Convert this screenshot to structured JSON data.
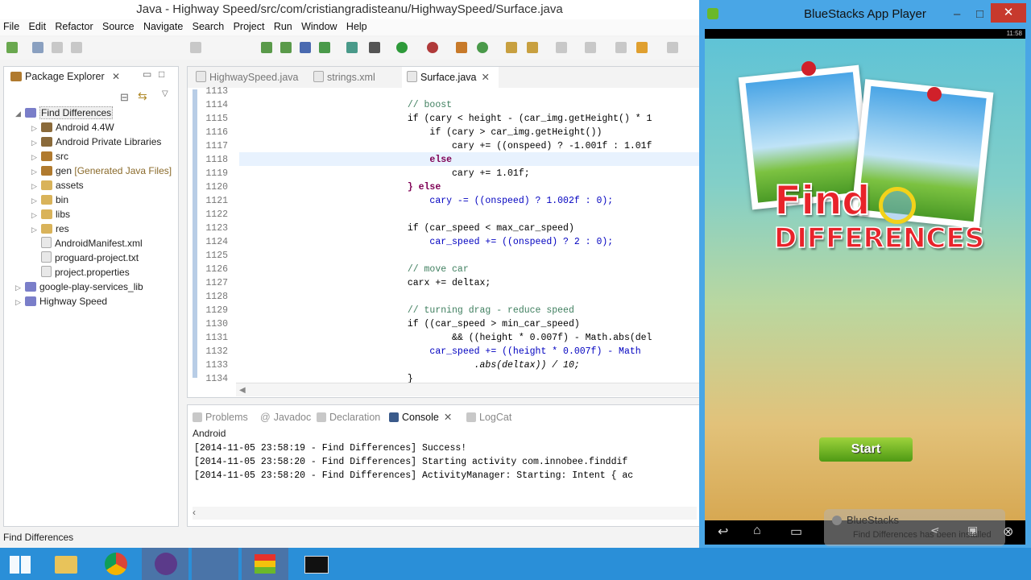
{
  "eclipse": {
    "title": "Java - Highway Speed/src/com/cristiangradisteanu/HighwaySpeed/Surface.java",
    "menu": [
      "File",
      "Edit",
      "Refactor",
      "Source",
      "Navigate",
      "Search",
      "Project",
      "Run",
      "Window",
      "Help"
    ],
    "package_explorer": {
      "tab_label": "Package Explorer",
      "items": [
        {
          "label": "Find Differences",
          "indent": 0,
          "icon": "project-icon",
          "expanded": true
        },
        {
          "label": "Android 4.4W",
          "indent": 1,
          "icon": "library-icon"
        },
        {
          "label": "Android Private Libraries",
          "indent": 1,
          "icon": "library-icon"
        },
        {
          "label": "src",
          "indent": 1,
          "icon": "source-folder-icon"
        },
        {
          "label": "gen",
          "extra": "[Generated Java Files]",
          "indent": 1,
          "icon": "source-folder-icon"
        },
        {
          "label": "assets",
          "indent": 1,
          "icon": "folder-icon"
        },
        {
          "label": "bin",
          "indent": 1,
          "icon": "folder-icon"
        },
        {
          "label": "libs",
          "indent": 1,
          "icon": "folder-icon"
        },
        {
          "label": "res",
          "indent": 1,
          "icon": "folder-icon"
        },
        {
          "label": "AndroidManifest.xml",
          "indent": 1,
          "icon": "file-icon"
        },
        {
          "label": "proguard-project.txt",
          "indent": 1,
          "icon": "file-icon"
        },
        {
          "label": "project.properties",
          "indent": 1,
          "icon": "file-icon"
        },
        {
          "label": "google-play-services_lib",
          "indent": 0,
          "icon": "project-icon"
        },
        {
          "label": "Highway Speed",
          "indent": 0,
          "icon": "project-icon"
        }
      ]
    },
    "editor": {
      "tabs": [
        "HighwaySpeed.java",
        "strings.xml",
        "Surface.java"
      ],
      "active_tab": 2,
      "lines": [
        {
          "n": "1113",
          "text": ""
        },
        {
          "n": "1114",
          "text": "            // boost"
        },
        {
          "n": "1115",
          "text": "            if (cary < height - (car_img.getHeight() * 1"
        },
        {
          "n": "1116",
          "text": "                if (cary > car_img.getHeight())"
        },
        {
          "n": "1117",
          "text": "                    cary += ((onspeed) ? -1.001f : 1.01f"
        },
        {
          "n": "1118",
          "text": "                else"
        },
        {
          "n": "1119",
          "text": "                    cary += 1.01f;"
        },
        {
          "n": "1120",
          "text": "            } else"
        },
        {
          "n": "1121",
          "text": "                cary -= ((onspeed) ? 1.002f : 0);"
        },
        {
          "n": "1122",
          "text": ""
        },
        {
          "n": "1123",
          "text": "            if (car_speed < max_car_speed)"
        },
        {
          "n": "1124",
          "text": "                car_speed += ((onspeed) ? 2 : 0);"
        },
        {
          "n": "1125",
          "text": ""
        },
        {
          "n": "1126",
          "text": "            // move car"
        },
        {
          "n": "1127",
          "text": "            carx += deltax;"
        },
        {
          "n": "1128",
          "text": ""
        },
        {
          "n": "1129",
          "text": "            // turning drag - reduce speed"
        },
        {
          "n": "1130",
          "text": "            if ((car_speed > min_car_speed)"
        },
        {
          "n": "1131",
          "text": "                    && ((height * 0.007f) - Math.abs(del"
        },
        {
          "n": "1132",
          "text": "                car_speed += ((height * 0.007f) - Math"
        },
        {
          "n": "1133",
          "text": "                        .abs(deltax)) / 10;"
        },
        {
          "n": "1134",
          "text": "            }"
        }
      ]
    },
    "console": {
      "tabs": [
        "Problems",
        "Javadoc",
        "Declaration",
        "Console",
        "LogCat"
      ],
      "active_tab": 3,
      "header": "Android",
      "lines": [
        "[2014-11-05 23:58:19 - Find Differences] Success!",
        "[2014-11-05 23:58:20 - Find Differences] Starting activity com.innobee.finddif",
        "[2014-11-05 23:58:20 - Find Differences] ActivityManager: Starting: Intent { ac"
      ]
    },
    "status": "Find Differences"
  },
  "bluestacks": {
    "title": "BlueStacks App Player",
    "clock": "11:58",
    "logo_line1": "Find",
    "logo_line2": "DIFFERENCES",
    "start_label": "Start",
    "toast_title": "BlueStacks",
    "toast_text": "Find Differences has been installed"
  },
  "taskbar": {
    "apps": [
      "windows-start-icon",
      "file-explorer-icon",
      "chrome-icon",
      "eclipse-icon",
      "blank-window-icon",
      "bluestacks-icon",
      "command-prompt-icon"
    ]
  },
  "colors": {
    "accent": "#2a8fd8",
    "keyword": "#7f0055",
    "comment": "#3f7f5f",
    "field": "#0000c0"
  }
}
